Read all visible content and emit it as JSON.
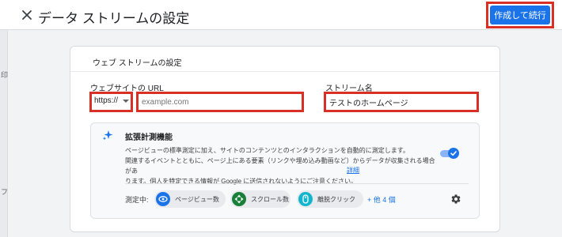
{
  "header": {
    "title": "データ ストリームの設定",
    "primary_button": "作成して続行"
  },
  "left_strip": {
    "frag_a": "印",
    "frag_b": "フ"
  },
  "card": {
    "title": "ウェブ ストリームの設定",
    "url_label": "ウェブサイトの URL",
    "protocol_value": "https://",
    "url_placeholder": "example.com",
    "stream_label": "ストリーム名",
    "stream_value": "テストのホームページ"
  },
  "enhanced": {
    "title": "拡張計測機能",
    "desc_line1": "ページビューの標準測定に加え、サイトのコンテンツとのインタラクションを自動的に測定します。",
    "desc_line2": "関連するイベントとともに、ページ上にある要素（リンクや埋め込み動画など）からデータが収集される場合があ",
    "desc_line3": "ります。個人を特定できる情報が Google に送信されないようにご注意ください。",
    "link": "詳細",
    "toggle_on": true,
    "measuring_label": "測定中:",
    "chips": [
      {
        "label": "ページビュー数",
        "color": "#1a73e8"
      },
      {
        "label": "スクロール数",
        "color": "#188038"
      },
      {
        "label": "離脱クリック",
        "color": "#12b5cb"
      }
    ],
    "more": "+ 他 4 個"
  },
  "colors": {
    "accent": "#1a73e8",
    "highlight": "#d93025"
  }
}
